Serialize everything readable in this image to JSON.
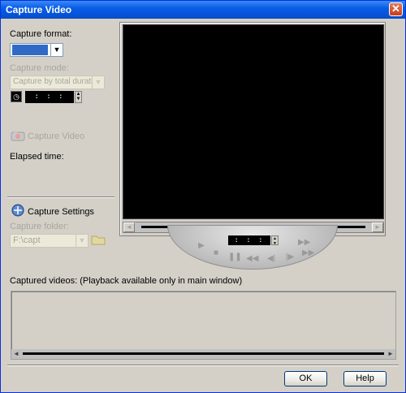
{
  "window": {
    "title": "Capture Video"
  },
  "capture_format": {
    "label": "Capture format:"
  },
  "capture_mode": {
    "label": "Capture mode:",
    "value": "Capture by total duration"
  },
  "duration": {
    "value": ":  :  :"
  },
  "capture_video": {
    "label": "Capture Video"
  },
  "elapsed": {
    "label": "Elapsed time:"
  },
  "settings": {
    "label": "Capture Settings"
  },
  "folder": {
    "label": "Capture folder:",
    "value": "F:\\capt"
  },
  "player": {
    "timecode": ":  :  :"
  },
  "captured_videos": {
    "label": "Captured videos: (Playback available only in main window)"
  },
  "buttons": {
    "ok": "OK",
    "help": "Help"
  }
}
